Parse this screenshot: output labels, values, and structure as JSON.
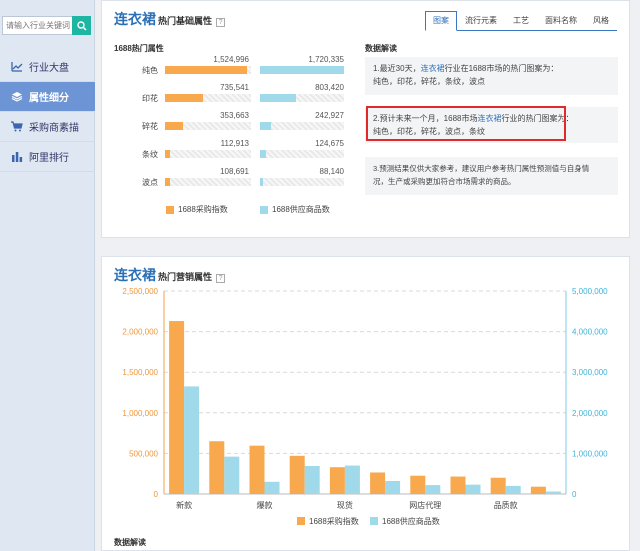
{
  "sidebar": {
    "search_placeholder": "请输入行业关键词",
    "items": [
      {
        "label": "行业大盘",
        "icon": "chart-icon"
      },
      {
        "label": "属性细分",
        "icon": "layers-icon"
      },
      {
        "label": "采购商素描",
        "icon": "cart-icon"
      },
      {
        "label": "阿里排行",
        "icon": "bars-icon"
      }
    ]
  },
  "panel1": {
    "title_big": "连衣裙",
    "title_small": "热门基础属性",
    "tabs": [
      "图案",
      "流行元素",
      "工艺",
      "面料名称",
      "风格"
    ],
    "subhead_left": "1688热门属性",
    "subhead_right": "数据解读",
    "rows": [
      {
        "label": "纯色",
        "purchase": "1,524,996",
        "supply": "1,720,335",
        "p_frac": 0.95,
        "s_frac": 1.0
      },
      {
        "label": "印花",
        "purchase": "735,541",
        "supply": "803,420",
        "p_frac": 0.44,
        "s_frac": 0.43
      },
      {
        "label": "碎花",
        "purchase": "353,663",
        "supply": "242,927",
        "p_frac": 0.21,
        "s_frac": 0.13
      },
      {
        "label": "条纹",
        "purchase": "112,913",
        "supply": "124,675",
        "p_frac": 0.06,
        "s_frac": 0.07
      },
      {
        "label": "波点",
        "purchase": "108,691",
        "supply": "88,140",
        "p_frac": 0.06,
        "s_frac": 0.04
      }
    ],
    "legend_purchase": "1688采购指数",
    "legend_supply": "1688供应商品数",
    "notes": [
      {
        "pre": "1.最近30天，",
        "hl": "连衣裙",
        "post": "行业在1688市场的热门图案为：",
        "line2": "纯色，印花，碎花，条纹，波点"
      },
      {
        "pre": "2.预计未来一个月，1688市场",
        "hl": "连衣裙",
        "post": "行业的热门图案为：",
        "line2": "纯色，印花，碎花，波点，条纹"
      },
      {
        "pre": "3.预测结果仅供大家参考，建议用户参考热门属性预测值与自身情",
        "hl": "",
        "post": "",
        "line2": "况，生产或采购更加符合市场需求的商品。"
      }
    ]
  },
  "panel2": {
    "title_big": "连衣裙",
    "title_small": "热门营销属性",
    "footer_label": "数据解读"
  },
  "colors": {
    "purchase": "#f8a94e",
    "supply": "#9fd9ea",
    "accent": "#2c6fb7",
    "highlight_box": "#e02a2a"
  },
  "chart_data": {
    "type": "bar",
    "categories": [
      "新款",
      "",
      "爆款",
      "",
      "现货",
      "",
      "网店代理",
      "",
      "品质款",
      ""
    ],
    "x_tick_labels": [
      "新款",
      "爆款",
      "现货",
      "网店代理",
      "品质款"
    ],
    "series": [
      {
        "name": "1688采购指数",
        "axis": "left",
        "values": [
          2130000,
          650000,
          595000,
          470000,
          330000,
          265000,
          225000,
          215000,
          200000,
          90000
        ]
      },
      {
        "name": "1688供应商品数",
        "axis": "right",
        "values": [
          2650000,
          920000,
          300000,
          690000,
          700000,
          320000,
          220000,
          230000,
          200000,
          60000
        ]
      }
    ],
    "y_left": {
      "ticks": [
        "0",
        "500,000",
        "1,000,000",
        "1,500,000",
        "2,000,000",
        "2,500,000"
      ],
      "max": 2500000
    },
    "y_right": {
      "ticks": [
        "0",
        "1,000,000",
        "2,000,000",
        "3,000,000",
        "4,000,000",
        "5,000,000"
      ],
      "max": 5000000
    },
    "grid": true,
    "legend": "bottom"
  }
}
